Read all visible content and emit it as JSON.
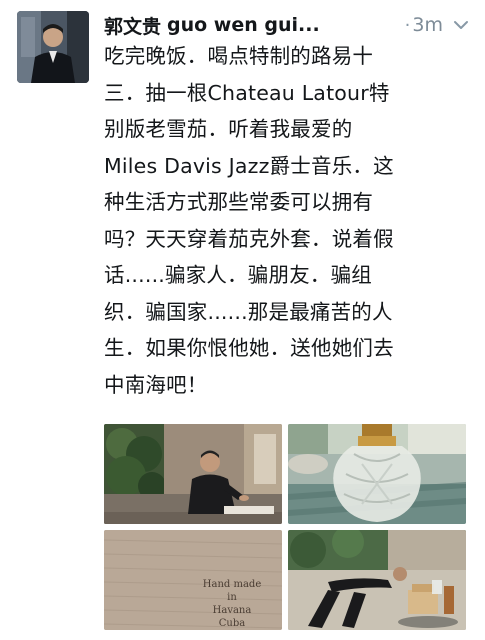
{
  "tweet": {
    "display_name": "郭文贵",
    "handle": "guo wen gui...",
    "separator": "·",
    "time": "3m",
    "chevron_icon": "chevron-down-icon",
    "lines": [
      "吃完晚饭．喝点特制的路易十",
      "三．抽一根Chateau Latour特",
      "别版老雪茄．听着我最爱的",
      "Miles Davis Jazz爵士音乐．这",
      "种生活方式那些常委可以拥有",
      "吗？天天穿着茄克外套．说着假",
      "话......骗家人．骗朋友．骗组",
      "织．骗国家......那是最痛苦的人",
      "生．如果你恨他她．送他她们去",
      "中南海吧！"
    ]
  },
  "media": {
    "photo4_text_lines": [
      "Hand made",
      "in",
      "Havana Cuba"
    ]
  },
  "colors": {
    "text": "#14171a",
    "secondary": "#8899a6",
    "background": "#ffffff"
  }
}
